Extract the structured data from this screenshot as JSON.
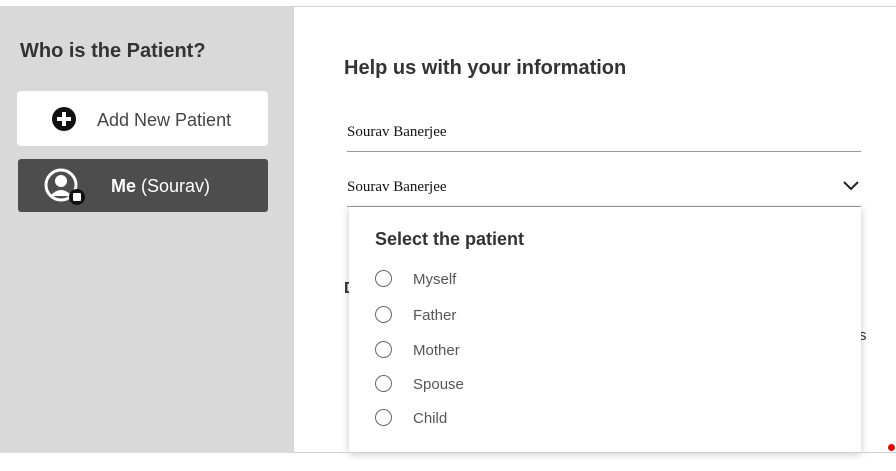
{
  "sidebar": {
    "title": "Who is the Patient?",
    "add_button": {
      "label": "Add New Patient",
      "icon": "plus-circle-icon"
    },
    "me_button": {
      "name": "Me",
      "detail": "(Sourav)",
      "icon": "user-avatar-icon",
      "bg_color": "#4d4d4d"
    }
  },
  "main": {
    "heading": "Help us with your information",
    "name_field": {
      "value": "Sourav Banerjee"
    },
    "patient_select": {
      "value": "Sourav Banerjee",
      "icon": "chevron-down-icon"
    },
    "partial_texts": {
      "letter_d": "D",
      "letter_s": "s"
    }
  },
  "dropdown": {
    "title": "Select the patient",
    "options": [
      {
        "label": "Myself",
        "selected": false
      },
      {
        "label": "Father",
        "selected": false
      },
      {
        "label": "Mother",
        "selected": false
      },
      {
        "label": "Spouse",
        "selected": false
      },
      {
        "label": "Child",
        "selected": false
      }
    ]
  },
  "colors": {
    "sidebar_bg": "#d9d9d9",
    "accent_dot": "#e00000"
  }
}
